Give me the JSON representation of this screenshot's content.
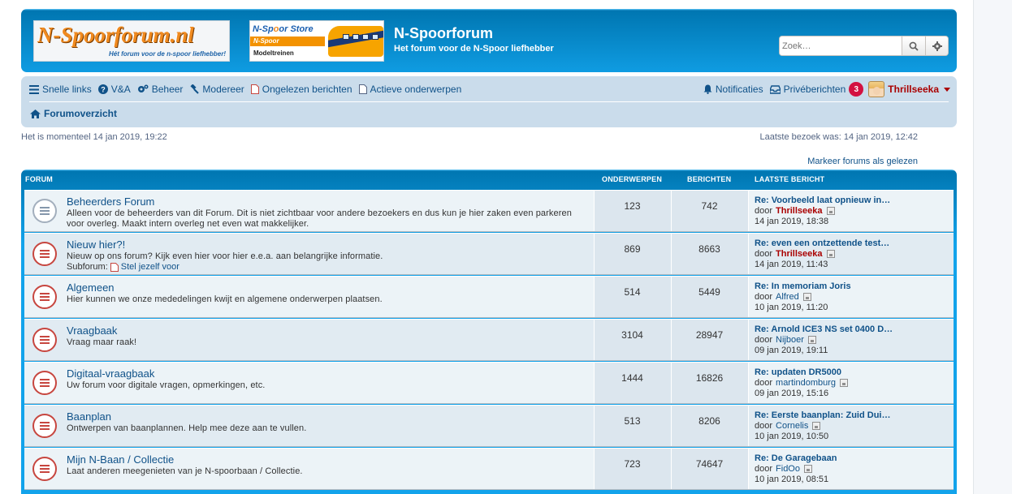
{
  "header": {
    "logo_main": "N-Spoorforum.nl",
    "logo_tagline": "Hét forum voor de n-spoor liefhebber!",
    "store_logo": {
      "title_a": "N-Sp",
      "title_o": "o",
      "title_b": "or Store",
      "band": "N-Spoor",
      "sub": "Modeltreinen"
    },
    "site_title": "N-Spoorforum",
    "site_description": "Het forum voor de N-Spoor liefhebber",
    "search_placeholder": "Zoek…",
    "search_button_icon": "magnifier-icon",
    "advanced_search_icon": "gear-icon"
  },
  "navbar": {
    "left": [
      {
        "label": "Snelle links",
        "icon": "bars-icon"
      },
      {
        "label": "V&A",
        "icon": "question-icon"
      },
      {
        "label": "Beheer",
        "icon": "cogs-icon"
      },
      {
        "label": "Modereer",
        "icon": "gavel-icon"
      },
      {
        "label": "Ongelezen berichten",
        "icon": "file-icon"
      },
      {
        "label": "Actieve onderwerpen",
        "icon": "file-icon"
      }
    ],
    "notifications_label": "Notificaties",
    "pm_label": "Privéberichten",
    "pm_count": "3",
    "username": "Thrillseeka",
    "breadcrumb": "Forumoverzicht"
  },
  "status": {
    "current_time": "Het is momenteel 14 jan 2019, 19:22",
    "last_visit": "Laatste bezoek was: 14 jan 2019, 12:42",
    "mark_read": "Markeer forums als gelezen"
  },
  "forum_table": {
    "headers": {
      "forum": "FORUM",
      "topics": "ONDERWERPEN",
      "posts": "BERICHTEN",
      "last_post": "LAATSTE BERICHT"
    },
    "rows": [
      {
        "title": "Beheerders Forum",
        "description": "Alleen voor de beheerders van dit Forum. Dit is niet zichtbaar voor andere bezoekers en dus kun je hier zaken even parkeren voor overleg. Maakt intern overleg net even wat makkelijker.",
        "topics": "123",
        "posts": "742",
        "last_title": "Re: Voorbeeld laat opnieuw in…",
        "by": "door",
        "last_user": "Thrillseeka",
        "last_date": "14 jan 2019, 18:38",
        "unread": false
      },
      {
        "title": "Nieuw hier?!",
        "description": "Nieuw op ons forum? Kijk even hier voor hier e.e.a. aan belangrijke informatie.",
        "subforum_label": "Subforum:",
        "subforum": "Stel jezelf voor",
        "topics": "869",
        "posts": "8663",
        "last_title": "Re: even een ontzettende test…",
        "by": "door",
        "last_user": "Thrillseeka",
        "last_date": "14 jan 2019, 11:43",
        "unread": true
      },
      {
        "title": "Algemeen",
        "description": "Hier kunnen we onze mededelingen kwijt en algemene onderwerpen plaatsen.",
        "topics": "514",
        "posts": "5449",
        "last_title": "Re: In memoriam Joris",
        "by": "door",
        "last_user": "Alfred",
        "last_date": "10 jan 2019, 11:20",
        "unread": true
      },
      {
        "title": "Vraagbaak",
        "description": "Vraag maar raak!",
        "topics": "3104",
        "posts": "28947",
        "last_title": "Re: Arnold ICE3 NS set 0400 D…",
        "by": "door",
        "last_user": "Nijboer",
        "last_date": "09 jan 2019, 19:11",
        "unread": true
      },
      {
        "title": "Digitaal-vraagbaak",
        "description": "Uw forum voor digitale vragen, opmerkingen, etc.",
        "topics": "1444",
        "posts": "16826",
        "last_title": "Re: updaten DR5000",
        "by": "door",
        "last_user": "martindomburg",
        "last_date": "09 jan 2019, 15:16",
        "unread": true
      },
      {
        "title": "Baanplan",
        "description": "Ontwerpen van baanplannen. Help mee deze aan te vullen.",
        "topics": "513",
        "posts": "8206",
        "last_title": "Re: Eerste baanplan: Zuid Dui…",
        "by": "door",
        "last_user": "Cornelis",
        "last_date": "10 jan 2019, 10:50",
        "unread": true
      },
      {
        "title": "Mijn N-Baan / Collectie",
        "description": "Laat anderen meegenieten van je N-spoorbaan / Collectie.",
        "topics": "723",
        "posts": "74647",
        "last_title": "Re: De Garagebaan",
        "by": "door",
        "last_user": "FidOo",
        "last_date": "10 jan 2019, 08:51",
        "unread": true
      }
    ]
  },
  "colors": {
    "header_blue": "#12a3eb",
    "nav_bg": "#cadceb",
    "link": "#105289",
    "username_red": "#aa0000",
    "badge": "#d31141"
  }
}
